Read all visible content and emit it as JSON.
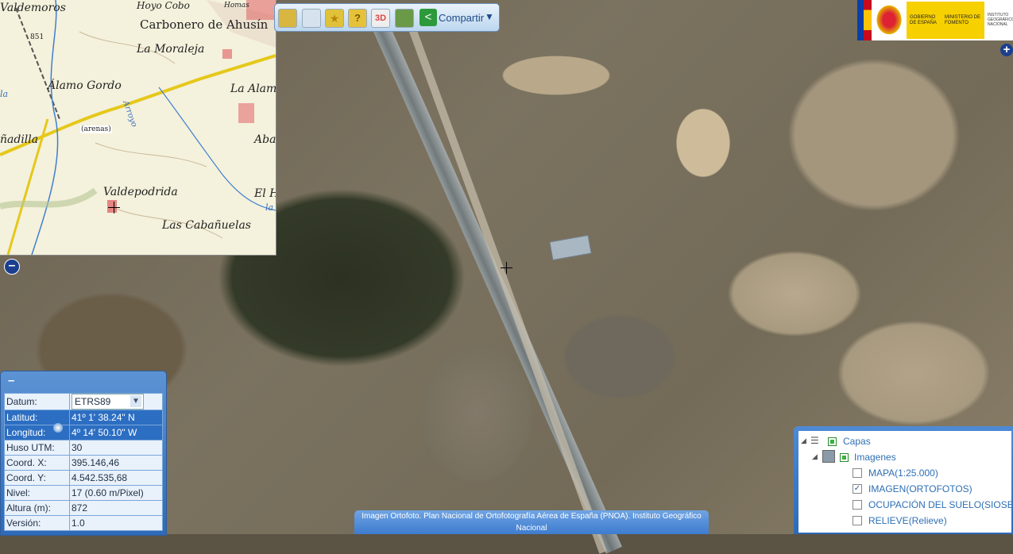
{
  "toolbar": {
    "buttons": [
      {
        "icon": "ruler-icon",
        "color": "#d8b640"
      },
      {
        "icon": "mail-icon",
        "color": "#d6e3ef"
      },
      {
        "icon": "star-icon",
        "color": "#e0c23a"
      },
      {
        "icon": "help-icon",
        "color": "#e6c23a"
      },
      {
        "icon": "3d-icon",
        "color": "#d44"
      },
      {
        "icon": "landscape-icon",
        "color": "#6a9a48"
      }
    ],
    "share_label": "Compartir"
  },
  "logo": {
    "gobierno": "GOBIERNO DE ESPAÑA",
    "ministerio": "MINISTERIO DE FOMENTO",
    "instituto": "INSTITUTO GEOGRÁFICO NACIONAL"
  },
  "overview_map": {
    "labels": [
      "Valdemoros",
      "Hoyo Cobo",
      "Homas",
      "851",
      "Carbonero de Ahusín",
      "La Moraleja",
      "Álamo Gordo",
      "La Alamo",
      "Arroyo",
      "(arenas)",
      "Abar",
      "ñadilla",
      "Valdepodrida",
      "El H",
      "Las Cabañuelas",
      "la",
      "la"
    ]
  },
  "coordinates": {
    "rows": [
      {
        "label": "Datum:",
        "value": "ETRS89"
      },
      {
        "label": "Latitud:",
        "value": "41º 1' 38.24\" N"
      },
      {
        "label": "Longitud:",
        "value": "4º 14' 50.10\" W"
      },
      {
        "label": "Huso UTM:",
        "value": "30"
      },
      {
        "label": "Coord. X:",
        "value": "395.146,46"
      },
      {
        "label": "Coord. Y:",
        "value": "4.542.535,68"
      },
      {
        "label": "Nivel:",
        "value": "17 (0.60 m/Pixel)"
      },
      {
        "label": "Altura (m):",
        "value": "872"
      },
      {
        "label": "Versión:",
        "value": "1.0"
      }
    ]
  },
  "caption": "Imagen Ortofoto. Plan Nacional de Ortofotografía Aérea de España (PNOA). Instituto Geográfico Nacional",
  "layers": {
    "root": "Capas",
    "group": "Imagenes",
    "items": [
      {
        "label": "MAPA(1:25.000)",
        "checked": false
      },
      {
        "label": "IMAGEN(ORTOFOTOS)",
        "checked": true
      },
      {
        "label": "OCUPACIÓN DEL SUELO(SIOSE)",
        "checked": false
      },
      {
        "label": "RELIEVE(Relieve)",
        "checked": false
      }
    ]
  }
}
